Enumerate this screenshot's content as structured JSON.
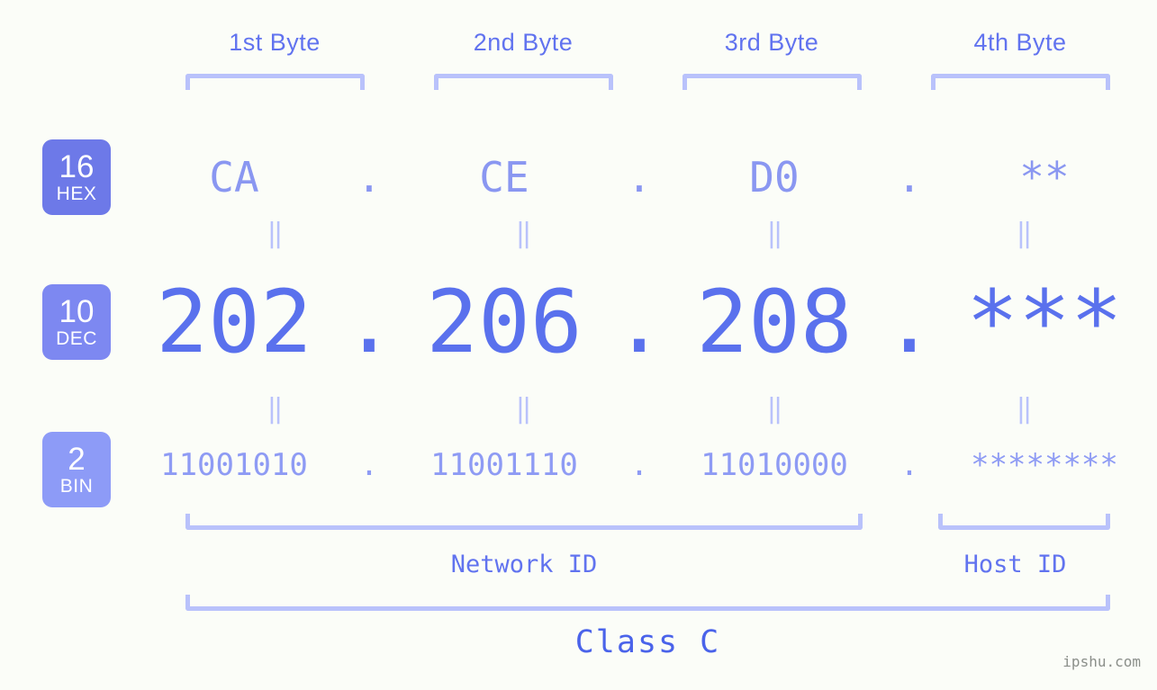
{
  "background_color": "#fbfdf8",
  "byte_headers": [
    {
      "label": "1st Byte"
    },
    {
      "label": "2nd Byte"
    },
    {
      "label": "3rd Byte"
    },
    {
      "label": "4th Byte"
    }
  ],
  "radix_badges": [
    {
      "number": "16",
      "name": "HEX",
      "color": "#6d79e8"
    },
    {
      "number": "10",
      "name": "DEC",
      "color": "#7d88f1"
    },
    {
      "number": "2",
      "name": "BIN",
      "color": "#8d9bf7"
    }
  ],
  "rows": {
    "hex": {
      "radix": "16",
      "radix_name": "HEX",
      "color": "#8a97f1",
      "bytes": [
        "CA",
        "CE",
        "D0",
        "**"
      ],
      "separator": "."
    },
    "dec": {
      "radix": "10",
      "radix_name": "DEC",
      "color": "#5a71ed",
      "bytes": [
        "202",
        "206",
        "208",
        "***"
      ],
      "separator": "."
    },
    "bin": {
      "radix": "2",
      "radix_name": "BIN",
      "color": "#8e9bf4",
      "bytes": [
        "11001010",
        "11001110",
        "11010000",
        "********"
      ],
      "separator": "."
    }
  },
  "connector_symbol": "‖",
  "footer": {
    "network_id_label": "Network ID",
    "host_id_label": "Host ID",
    "class_label": "Class C"
  },
  "watermark": "ipshu.com",
  "accent_color": "#6173ef",
  "bracket_color": "#b9c2fb"
}
